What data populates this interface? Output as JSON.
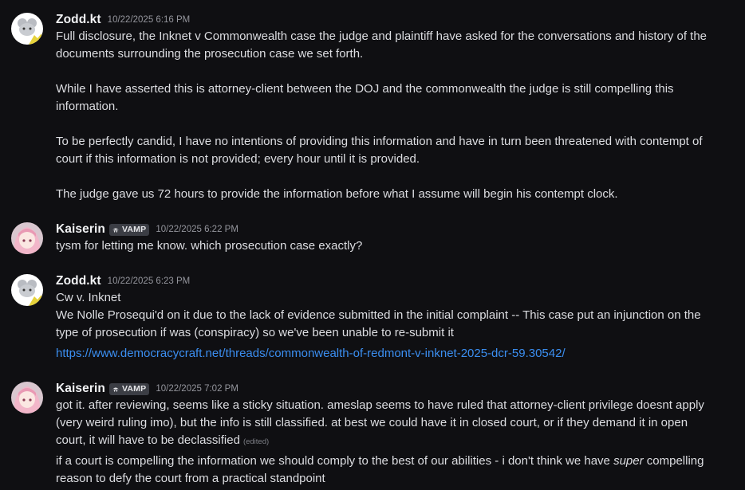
{
  "messages": [
    {
      "author": "Zodd.kt",
      "timestamp": "10/22/2025 6:16 PM",
      "avatar": "mouse-avatar",
      "lines": [
        "Full disclosure, the Inknet v Commonwealth case the judge and plaintiff have asked for the conversations and history of the",
        "documents surrounding the prosecution case we set forth.",
        "While I have asserted this is attorney-client between the DOJ and the commonwealth the judge is still compelling this",
        "information.",
        "To be perfectly candid, I have no intentions of providing this information and have in turn been threatened with contempt of",
        "court if this information is not provided; every hour until it is provided.",
        "The judge gave us 72 hours to provide the information before what I assume will begin his contempt clock."
      ]
    },
    {
      "author": "Kaiserin",
      "tag": "VAMP",
      "timestamp": "10/22/2025 6:22 PM",
      "avatar": "anime-girl-avatar",
      "lines": [
        "tysm for letting me know. which prosecution case exactly?"
      ]
    },
    {
      "author": "Zodd.kt",
      "timestamp": "10/22/2025 6:23 PM",
      "avatar": "mouse-avatar",
      "lines": [
        "Cw v. Inknet",
        "We Nolle Prosequi'd on it due to the lack of evidence submitted in the initial complaint -- This case put an injunction on the",
        "type of prosecution if was (conspiracy) so we've been unable to re-submit it"
      ],
      "link": "https://www.democracycraft.net/threads/commonwealth-of-redmont-v-inknet-2025-dcr-59.30542/"
    },
    {
      "author": "Kaiserin",
      "tag": "VAMP",
      "timestamp": "10/22/2025 7:02 PM",
      "avatar": "anime-girl-avatar",
      "lines": [
        "got it. after reviewing, seems like a sticky situation. ameslap seems to have ruled that attorney-client privilege doesnt apply",
        "(very weird ruling imo), but the info is still classified. at best we could have it in closed court, or if they demand it in open",
        "court, it will have to be declassified"
      ],
      "edited": "(edited)",
      "followup_before": "if a court is compelling the information we should comply to the best of our abilities - i don't think we have ",
      "followup_italic": "super",
      "followup_after": " compelling",
      "followup_line2": "reason to defy the court from a practical standpoint"
    }
  ]
}
